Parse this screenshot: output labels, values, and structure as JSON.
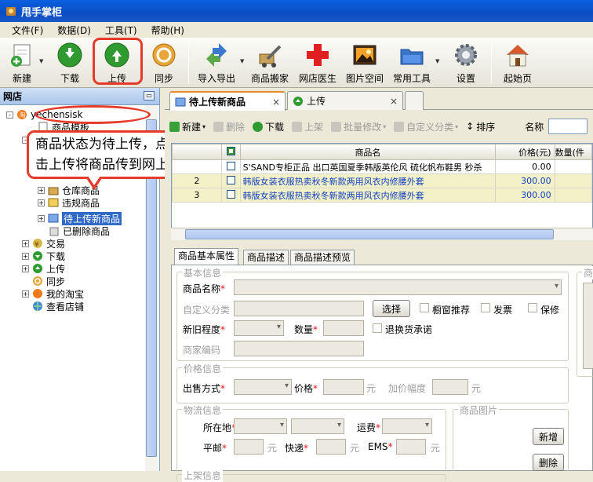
{
  "window": {
    "title": "甩手掌柜"
  },
  "menu": [
    {
      "label": "文件(F)"
    },
    {
      "label": "数据(D)"
    },
    {
      "label": "工具(T)"
    },
    {
      "label": "帮助(H)"
    }
  ],
  "toolbar": [
    {
      "label": "新建",
      "icon": "new-icon"
    },
    {
      "label": "下载",
      "icon": "download-icon"
    },
    {
      "label": "上传",
      "icon": "upload-icon"
    },
    {
      "label": "同步",
      "icon": "sync-icon"
    },
    {
      "label": "导入导出",
      "icon": "import-export-icon"
    },
    {
      "label": "商品搬家",
      "icon": "move-products-icon"
    },
    {
      "label": "网店医生",
      "icon": "shop-doctor-icon"
    },
    {
      "label": "图片空间",
      "icon": "image-space-icon"
    },
    {
      "label": "常用工具",
      "icon": "tools-icon"
    },
    {
      "label": "设置",
      "icon": "settings-icon"
    },
    {
      "label": "起始页",
      "icon": "home-icon"
    }
  ],
  "left_panel": {
    "title": "网店",
    "tree": [
      {
        "label": "yechensisk",
        "level": 0,
        "expand": "-"
      },
      {
        "label": "商品模板",
        "level": 2,
        "expand": ""
      },
      {
        "label": "",
        "level": 1,
        "expand": "-"
      },
      {
        "label": "",
        "level": 2,
        "expand": ""
      },
      {
        "label": "仓库商品",
        "level": 2,
        "expand": "+"
      },
      {
        "label": "违规商品",
        "level": 2,
        "expand": "+"
      },
      {
        "label": "待上传新商品",
        "level": 2,
        "expand": "+",
        "selected": true
      },
      {
        "label": "已删除商品",
        "level": 2,
        "expand": ""
      },
      {
        "label": "交易",
        "level": 1,
        "expand": "+"
      },
      {
        "label": "下载",
        "level": 1,
        "expand": "+"
      },
      {
        "label": "上传",
        "level": 1,
        "expand": "+"
      },
      {
        "label": "同步",
        "level": 1,
        "expand": ""
      },
      {
        "label": "我的淘宝",
        "level": 1,
        "expand": "+"
      },
      {
        "label": "查看店铺",
        "level": 1,
        "expand": ""
      }
    ]
  },
  "callout": {
    "line1": "商品状态为待上传，点",
    "line2": "击上传将商品传到网上"
  },
  "tabs": [
    {
      "label": "待上传新商品",
      "close": "×",
      "active": true
    },
    {
      "label": "上传",
      "close": "×",
      "active": false
    }
  ],
  "list_toolbar": {
    "new": "新建",
    "delete": "删除",
    "download": "下载",
    "shelve": "上架",
    "batch_edit": "批量修改",
    "custom_category": "自定义分类",
    "sort": "排序",
    "name_label": "名称"
  },
  "grid": {
    "columns": [
      "",
      "",
      "商品名",
      "价格(元)",
      "数量(件"
    ],
    "rows": [
      {
        "no": "",
        "name": "S'SAND专柜正品 出口英国夏季韩版英伦风 硫化帆布鞋男 秒杀",
        "price": "0.00",
        "qty": ""
      },
      {
        "no": "2",
        "name": "韩版女装衣服热卖秋冬新款两用风衣内修腰外套",
        "price": "300.00",
        "qty": ""
      },
      {
        "no": "3",
        "name": "韩版女装衣服热卖秋冬新款两用风衣内修腰外套",
        "price": "300.00",
        "qty": ""
      }
    ]
  },
  "detail_tabs": [
    "商品基本属性",
    "商品描述",
    "商品描述预览"
  ],
  "form": {
    "basic": {
      "legend": "基本信息",
      "name_label": "商品名称",
      "custom_cat_label": "自定义分类",
      "select_btn": "选择",
      "showcase": "橱窗推荐",
      "invoice": "发票",
      "warranty": "保修",
      "condition_label": "新旧程度",
      "qty_label": "数量",
      "return_label": "退换货承诺",
      "code_label": "商家编码",
      "right_legend": "商"
    },
    "price": {
      "legend": "价格信息",
      "sale_label": "出售方式",
      "price_label": "价格",
      "unit1": "元",
      "increment_label": "加价幅度",
      "unit2": "元"
    },
    "logistics": {
      "legend": "物流信息",
      "location_label": "所在地",
      "freight_label": "运费",
      "surface_label": "平邮",
      "unit1": "元",
      "express_label": "快递",
      "unit2": "元",
      "ems_label": "EMS",
      "unit3": "元"
    },
    "image": {
      "legend": "商品图片",
      "add": "新增",
      "delete": "删除"
    },
    "shelf": {
      "legend": "上架信息"
    }
  },
  "colors": {
    "highlight": "#e63a2a",
    "title_bar": "#0a5fe0",
    "price_blue": "#1040c0"
  }
}
